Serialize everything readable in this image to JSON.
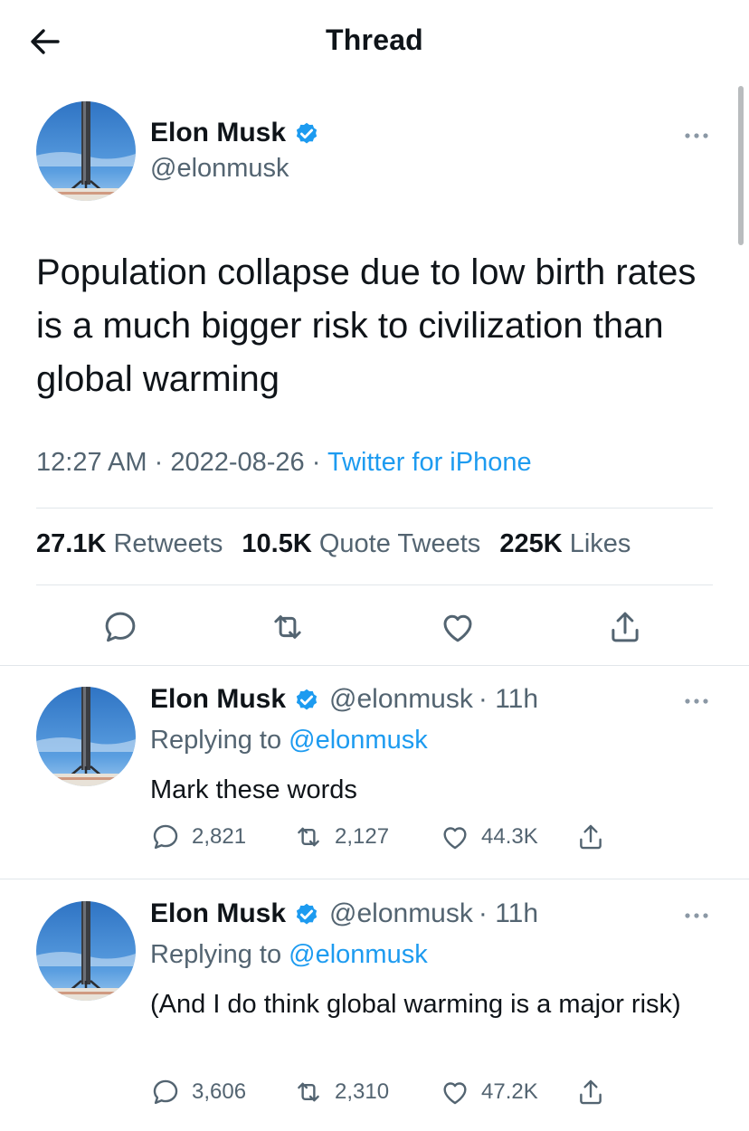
{
  "header": {
    "title": "Thread"
  },
  "main_tweet": {
    "author_name": "Elon Musk",
    "handle": "@elonmusk",
    "text": "Population collapse due to low birth rates is a much bigger risk to civilization than global warming",
    "time": "12:27 AM",
    "date": "2022-08-26",
    "separator": "·",
    "source": "Twitter for iPhone",
    "stats": {
      "retweets_count": "27.1K",
      "retweets_label": "Retweets",
      "quotes_count": "10.5K",
      "quotes_label": "Quote Tweets",
      "likes_count": "225K",
      "likes_label": "Likes"
    }
  },
  "replies": [
    {
      "author_name": "Elon Musk",
      "handle": "@elonmusk",
      "age": "· 11h",
      "replying_prefix": "Replying to",
      "replying_to": "@elonmusk",
      "text": "Mark these words",
      "reply_count": "2,821",
      "retweet_count": "2,127",
      "like_count": "44.3K"
    },
    {
      "author_name": "Elon Musk",
      "handle": "@elonmusk",
      "age": "· 11h",
      "replying_prefix": "Replying to",
      "replying_to": "@elonmusk",
      "text": "(And I do think global warming is a major risk)",
      "reply_count": "3,606",
      "retweet_count": "2,310",
      "like_count": "47.2K"
    }
  ],
  "colors": {
    "accent": "#1d9bf0",
    "muted": "#536471",
    "text": "#0f1419",
    "divider": "#e1e6ea"
  },
  "icons": [
    "back-arrow-icon",
    "verified-badge-icon",
    "more-icon",
    "reply-icon",
    "retweet-icon",
    "like-icon",
    "share-icon"
  ]
}
